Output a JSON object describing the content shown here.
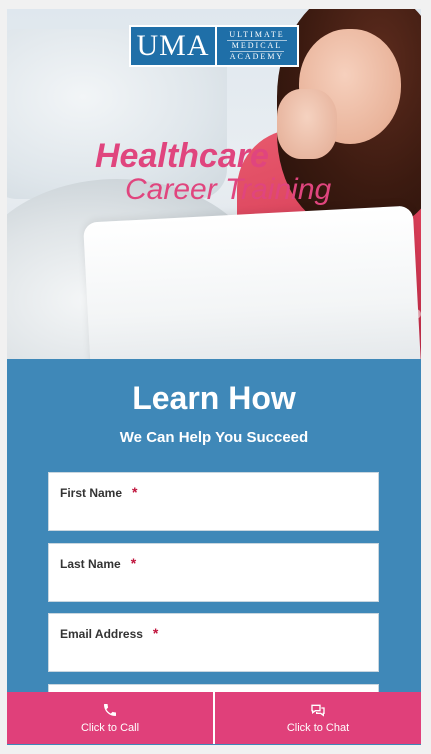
{
  "logo": {
    "primary": "UMA",
    "lines": [
      "ULTIMATE",
      "MEDICAL",
      "ACADEMY"
    ]
  },
  "hero": {
    "title_line1": "Healthcare",
    "title_line2": "Career Training"
  },
  "form": {
    "heading": "Learn How",
    "subheading": "We Can Help You Succeed",
    "fields": [
      {
        "label": "First Name",
        "required": "*",
        "value": ""
      },
      {
        "label": "Last Name",
        "required": "*",
        "value": ""
      },
      {
        "label": "Email Address",
        "required": "*",
        "value": ""
      }
    ]
  },
  "bottom_bar": {
    "call_label": "Click to Call",
    "chat_label": "Click to Chat",
    "call_icon": "phone-icon",
    "chat_icon": "chat-bubbles-icon"
  },
  "colors": {
    "form_background": "#3f88b8",
    "accent_pink": "#e0407a",
    "logo_blue": "#1f6fa8",
    "required_red": "#c0143c"
  }
}
